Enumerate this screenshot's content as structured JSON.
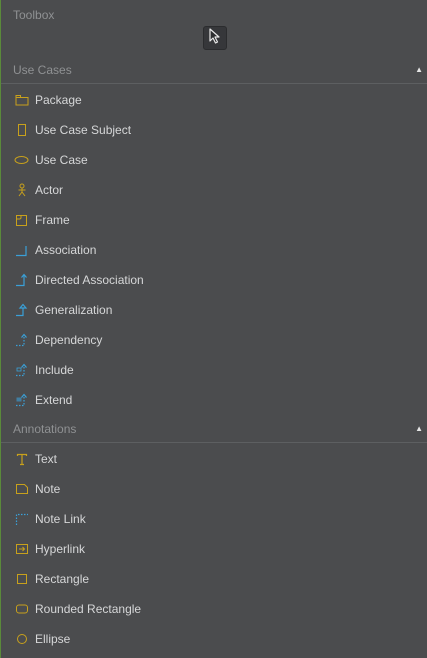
{
  "toolbox": {
    "title": "Toolbox",
    "pointer_icon": "cursor-arrow-icon"
  },
  "sections": [
    {
      "title": "Use Cases",
      "collapse_icon": "caret-up-icon",
      "items": [
        {
          "label": "Package",
          "icon": "package-icon"
        },
        {
          "label": "Use Case Subject",
          "icon": "use-case-subject-icon"
        },
        {
          "label": "Use Case",
          "icon": "use-case-icon"
        },
        {
          "label": "Actor",
          "icon": "actor-icon"
        },
        {
          "label": "Frame",
          "icon": "frame-icon"
        },
        {
          "label": "Association",
          "icon": "association-icon"
        },
        {
          "label": "Directed Association",
          "icon": "directed-association-icon"
        },
        {
          "label": "Generalization",
          "icon": "generalization-icon"
        },
        {
          "label": "Dependency",
          "icon": "dependency-icon"
        },
        {
          "label": "Include",
          "icon": "include-icon"
        },
        {
          "label": "Extend",
          "icon": "extend-icon"
        }
      ]
    },
    {
      "title": "Annotations",
      "collapse_icon": "caret-up-icon",
      "items": [
        {
          "label": "Text",
          "icon": "text-icon"
        },
        {
          "label": "Note",
          "icon": "note-icon"
        },
        {
          "label": "Note Link",
          "icon": "note-link-icon"
        },
        {
          "label": "Hyperlink",
          "icon": "hyperlink-icon"
        },
        {
          "label": "Rectangle",
          "icon": "rectangle-icon"
        },
        {
          "label": "Rounded Rectangle",
          "icon": "rounded-rectangle-icon"
        },
        {
          "label": "Ellipse",
          "icon": "ellipse-icon"
        }
      ]
    }
  ],
  "colors": {
    "background": "#4b4c4e",
    "text": "#d6d7d8",
    "muted_text": "#8f9193",
    "icon_yellow": "#c8a11c",
    "icon_blue": "#3aa0d8"
  }
}
